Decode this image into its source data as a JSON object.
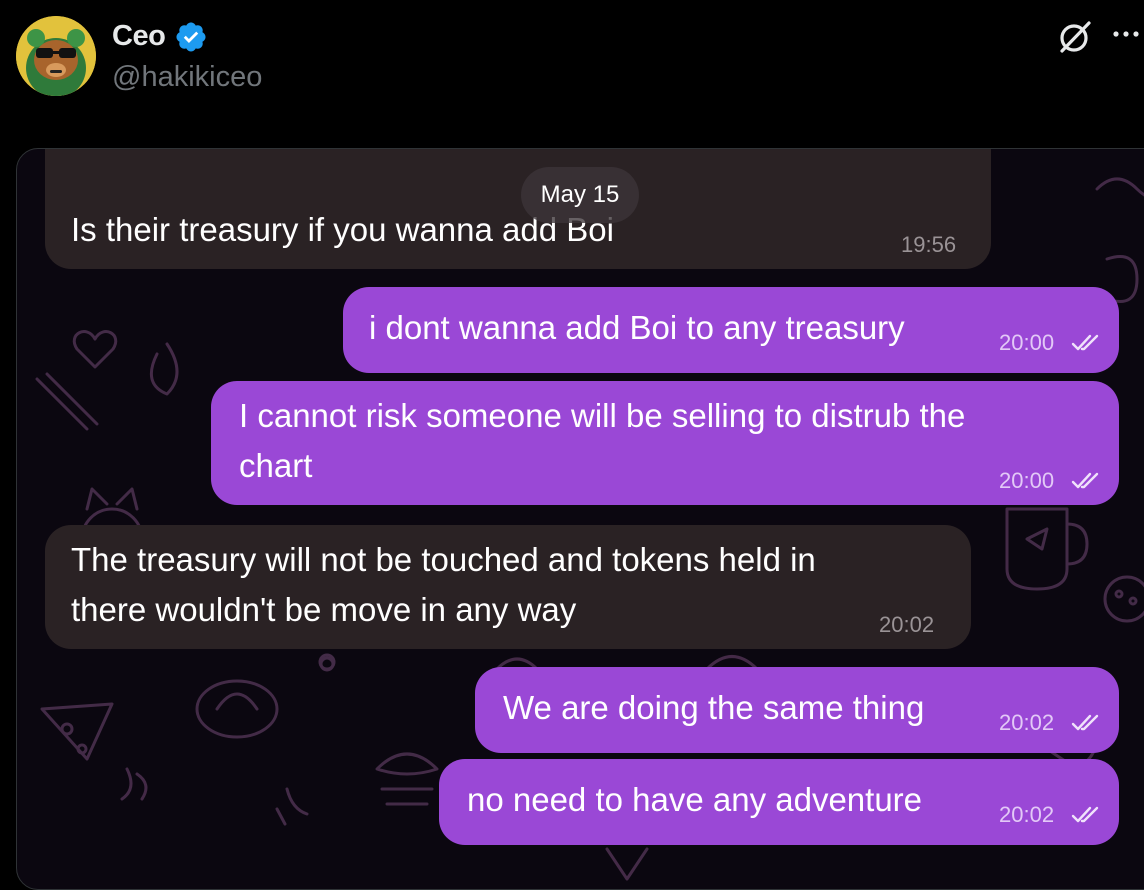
{
  "author": {
    "display_name": "Ceo",
    "handle": "@hakikiceo"
  },
  "chat": {
    "date_label": "May 15",
    "messages": [
      {
        "direction": "incoming",
        "text": "Is their treasury if you wanna add Boi",
        "time": "19:56"
      },
      {
        "direction": "outgoing",
        "text": "i dont wanna add Boi to any treasury",
        "time": "20:00",
        "status_icon": "double-check-icon"
      },
      {
        "direction": "outgoing",
        "text_line1": "I cannot risk someone will be selling to distrub the",
        "text_line2": "chart",
        "time": "20:00",
        "status_icon": "double-check-icon"
      },
      {
        "direction": "incoming",
        "text_line1": "The treasury will not be touched and tokens held in",
        "text_line2": "there wouldn't be move in any way",
        "time": "20:02"
      },
      {
        "direction": "outgoing",
        "text": "We are doing the same thing",
        "time": "20:02",
        "status_icon": "double-check-icon"
      },
      {
        "direction": "outgoing",
        "text": "no need to have any adventure",
        "time": "20:02",
        "status_icon": "double-check-icon"
      }
    ]
  },
  "colors": {
    "background": "#000000",
    "incoming_bubble": "#2a2224",
    "outgoing_bubble": "#9a48d6",
    "verified_badge": "#1d9bf0",
    "handle": "#71767b"
  }
}
